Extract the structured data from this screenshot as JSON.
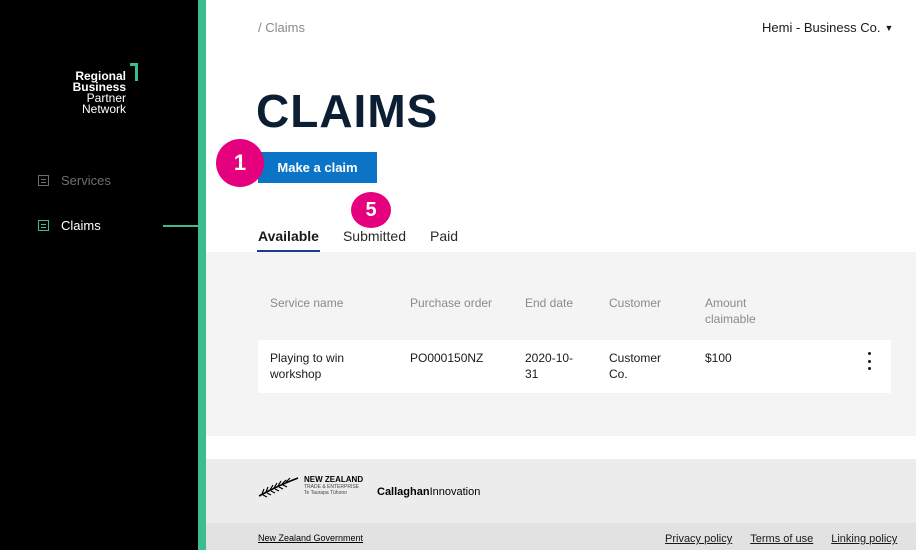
{
  "sidebar": {
    "logo_lines": [
      "Regional",
      "Business",
      "Partner",
      "Network"
    ],
    "items": [
      {
        "label": "Services",
        "icon": "list-icon",
        "active": false
      },
      {
        "label": "Claims",
        "icon": "list-icon",
        "active": true
      }
    ]
  },
  "colors": {
    "accent": "#3dbd8d",
    "primary_button": "#0b74c7",
    "badge": "#e5007e",
    "title": "#0b1e33"
  },
  "header": {
    "breadcrumb": "/ Claims",
    "user_menu": "Hemi - Business Co.",
    "user_menu_icon": "chevron-down-icon"
  },
  "main": {
    "title": "CLAIMS",
    "make_claim_label": "Make a claim",
    "badges": [
      "1",
      "5"
    ],
    "tabs": [
      {
        "label": "Available",
        "active": true
      },
      {
        "label": "Submitted",
        "active": false
      },
      {
        "label": "Paid",
        "active": false
      }
    ],
    "table": {
      "columns": [
        "Service name",
        "Purchase order",
        "End date",
        "Customer",
        "Amount claimable"
      ],
      "rows": [
        {
          "service_name": "Playing to win workshop",
          "purchase_order": "PO000150NZ",
          "end_date": "2020-10-31",
          "customer": "Customer Co.",
          "amount": "$100"
        }
      ]
    }
  },
  "footer": {
    "nz_logo": {
      "title": "NEW ZEALAND",
      "subtitle": "TRADE & ENTERPRISE",
      "tagline": "Te Taurapa Tūhono"
    },
    "callaghan": {
      "bold": "Callaghan",
      "regular": "Innovation"
    },
    "nz_government": "New Zealand Government",
    "links": [
      "Privacy policy",
      "Terms of use",
      "Linking policy"
    ]
  }
}
